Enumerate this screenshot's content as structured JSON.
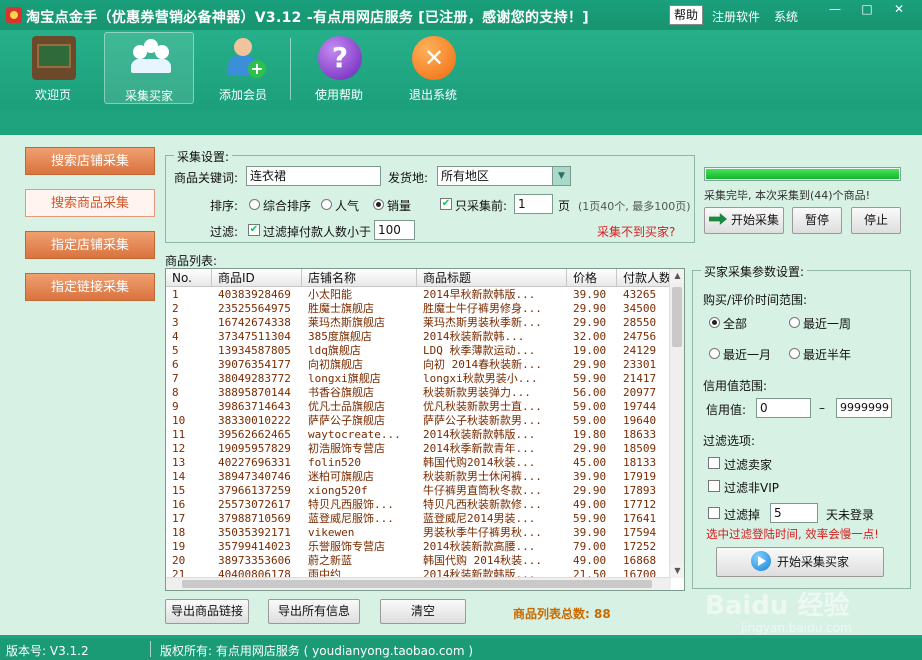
{
  "window": {
    "title": "淘宝点金手（优惠券营销必备神器）V3.12 -有点用网店服务 [已注册，感谢您的支持！]",
    "help_label": "帮助",
    "register_label": "注册软件",
    "system_label": "系统",
    "minimize": "—",
    "restore": "□",
    "close": "✕"
  },
  "toolbar": [
    {
      "label": "欢迎页",
      "icon": "welcome-board-icon"
    },
    {
      "label": "采集买家",
      "icon": "users-group-icon"
    },
    {
      "label": "添加会员",
      "icon": "add-user-icon"
    },
    {
      "label": "使用帮助",
      "icon": "question-icon"
    },
    {
      "label": "退出系统",
      "icon": "exit-icon"
    }
  ],
  "sidebar": [
    {
      "label": "搜索店铺采集"
    },
    {
      "label": "搜索商品采集"
    },
    {
      "label": "指定店铺采集"
    },
    {
      "label": "指定链接采集"
    }
  ],
  "settings": {
    "section_title": "采集设置:",
    "keyword_label": "商品关键词:",
    "keyword_value": "连衣裙",
    "ship_from_label": "发货地:",
    "ship_from_value": "所有地区",
    "sort_label": "排序:",
    "sort_options": [
      "综合排序",
      "人气",
      "销量"
    ],
    "sort_selected": "销量",
    "only_first_label": "只采集前:",
    "only_first_value": "1",
    "page_unit": "页",
    "page_hint": "(1页40个, 最多100页)",
    "filter_label": "过滤:",
    "filter_payers_label": "过滤掉付款人数小于",
    "filter_payers_value": "100",
    "no_buyer_hint": "采集不到买家?"
  },
  "progress": {
    "percent": 100,
    "status_text": "采集完毕, 本次采集到(44)个商品!",
    "start_btn": "开始采集",
    "pause_btn": "暂停",
    "stop_btn": "停止"
  },
  "table": {
    "title": "商品列表:",
    "columns": [
      "No.",
      "商品ID",
      "店铺名称",
      "商品标题",
      "价格",
      "付款人数"
    ],
    "rows": [
      [
        "1",
        "40383928469",
        "小太阳能",
        "2014早秋新款韩版...",
        "39.90",
        "43265"
      ],
      [
        "2",
        "23525564975",
        "胜魔士旗舰店",
        "胜魔士牛仔裤男修身...",
        "29.90",
        "34500"
      ],
      [
        "3",
        "16742674338",
        "莱玛杰斯旗舰店",
        "莱玛杰斯男装秋季新...",
        "29.90",
        "28550"
      ],
      [
        "4",
        "37347511304",
        "385度旗舰店",
        "2014秋装新款韩...",
        "32.00",
        "24756"
      ],
      [
        "5",
        "13934587805",
        "ldq旗舰店",
        "LDQ 秋季薄款运动...",
        "19.00",
        "24129"
      ],
      [
        "6",
        "39076354177",
        "向初旗舰店",
        "向初 2014春秋装新...",
        "29.90",
        "23301"
      ],
      [
        "7",
        "38049283772",
        "longxi旗舰店",
        "longxi秋款男装小...",
        "59.90",
        "21417"
      ],
      [
        "8",
        "38895870144",
        "书香谷旗舰店",
        "秋装新款男装弹力...",
        "56.00",
        "20977"
      ],
      [
        "9",
        "39863714643",
        "优凡士品旗舰店",
        "优凡秋装新款男士直...",
        "59.00",
        "19744"
      ],
      [
        "10",
        "38330010222",
        "萨萨公子旗舰店",
        "萨萨公子秋装新款男...",
        "59.00",
        "19640"
      ],
      [
        "11",
        "39562662465",
        "waytocreate...",
        "2014秋装新款韩版...",
        "19.80",
        "18633"
      ],
      [
        "12",
        "19095957829",
        "初浩服饰专营店",
        "2014秋季新款青年...",
        "29.90",
        "18509"
      ],
      [
        "13",
        "40227696331",
        "folin520",
        "韩国代购2014秋装...",
        "45.00",
        "18133"
      ],
      [
        "14",
        "38947340746",
        "迷柏可旗舰店",
        "秋装新款男士休闲裤...",
        "39.90",
        "17919"
      ],
      [
        "15",
        "37966137259",
        "xiong520f",
        "牛仔裤男直筒秋冬款...",
        "29.90",
        "17893"
      ],
      [
        "16",
        "25573072617",
        "特贝凡西服饰...",
        "特贝凡西秋装新款修...",
        "49.00",
        "17712"
      ],
      [
        "17",
        "37988710569",
        "蓝登威尼服饰...",
        "蓝登威尼2014男装...",
        "59.90",
        "17641"
      ],
      [
        "18",
        "35035392171",
        "vikewen",
        "男装秋季牛仔裤男秋...",
        "39.90",
        "17594"
      ],
      [
        "19",
        "35799414023",
        "乐誉服饰专营店",
        "2014秋装新款高腰...",
        "79.00",
        "17252"
      ],
      [
        "20",
        "38973353606",
        "蔚之新蓝",
        "韩国代购 2014秋装...",
        "49.00",
        "16868"
      ]
    ],
    "partial_row": [
      "21",
      "40400806178",
      "雨中约",
      "2014秋装新款韩版...",
      "21.50",
      "16700"
    ]
  },
  "actions": {
    "export_links": "导出商品链接",
    "export_all": "导出所有信息",
    "clear": "清空",
    "total_label": "商品列表总数: 88"
  },
  "buyer_params": {
    "title": "买家采集参数设置:",
    "time_range_label": "购买/评价时间范围:",
    "time_options": [
      "全部",
      "最近一周",
      "最近一月",
      "最近半年"
    ],
    "time_selected": "全部",
    "credit_range_label": "信用值范围:",
    "credit_label": "信用值:",
    "credit_min": "0",
    "credit_dash": "–",
    "credit_max": "9999999",
    "filter_options_label": "过滤选项:",
    "filter_seller": "过滤卖家",
    "filter_non_vip": "过滤非VIP",
    "filter_login_prefix": "过滤掉",
    "filter_login_days": "5",
    "filter_login_suffix": "天未登录",
    "login_hint": "选中过滤登陆时间, 效率会慢一点!",
    "start_btn": "开始采集买家"
  },
  "statusbar": {
    "version": "版本号: V3.1.2",
    "copyright": "版权所有: 有点用网店服务 ( youdianyong.taobao.com )"
  },
  "watermark": {
    "brand": "Baidu 经验",
    "url": "jingyan.baidu.com"
  },
  "colors": {
    "accent_green": "#1fa37f",
    "panel_bg": "#d7f1e5",
    "sidebar_orange": "#e38150",
    "hint_red": "#d41f1f",
    "total_orange": "#c96a00",
    "progress_green": "#2fd143"
  }
}
